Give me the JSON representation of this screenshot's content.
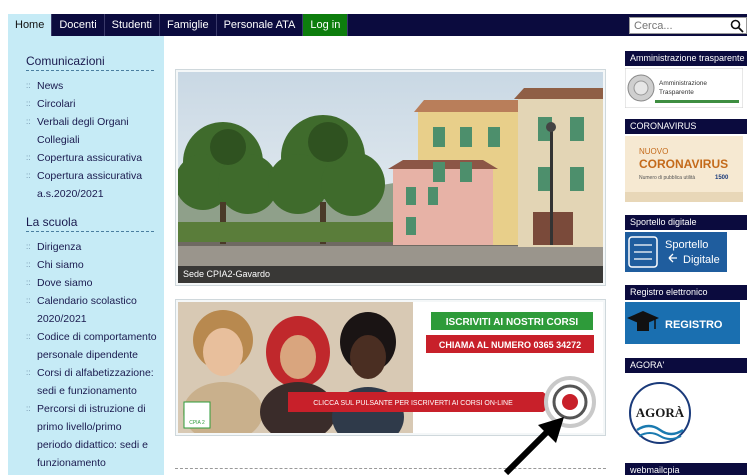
{
  "nav": {
    "items": [
      "Home",
      "Docenti",
      "Studenti",
      "Famiglie",
      "Personale ATA",
      "Log in"
    ],
    "active": "Home"
  },
  "search": {
    "placeholder": "Cerca..."
  },
  "sidebar": {
    "section1": {
      "title": "Comunicazioni",
      "links": [
        "News",
        "Circolari",
        "Verbali degli Organi Collegiali",
        "Copertura assicurativa",
        "Copertura assicurativa a.s.2020/2021"
      ]
    },
    "section2": {
      "title": "La scuola",
      "links": [
        "Dirigenza",
        "Chi siamo",
        "Dove siamo",
        "Calendario scolastico 2020/2021",
        "Codice di comportamento personale dipendente",
        "Corsi di alfabetizzazione: sedi e funzionamento",
        "Percorsi di istruzione di primo livello/primo periodo didattico: sedi e funzionamento"
      ]
    }
  },
  "photo": {
    "caption": "Sede CPIA2-Gavardo"
  },
  "banner": {
    "headline": "ISCRIVITI AI NOSTRI CORSI",
    "phone": "CHIAMA AL NUMERO 0365 34272",
    "cta": "CLICCA SUL PULSANTE PER ISCRIVERTI AI CORSI ON-LINE",
    "logo_text": "CPIA 2"
  },
  "right": {
    "amministrazione": {
      "title": "Amministrazione trasparente",
      "logo_line1": "Amministrazione",
      "logo_line2": "Trasparente"
    },
    "coronavirus": {
      "title": "CORONAVIRUS",
      "small": "NUOVO",
      "big": "CORONAVIRUS",
      "sub": "Numero di pubblica utilità",
      "number": "1500"
    },
    "sportello": {
      "title": "Sportello digitale",
      "line1": "Sportello",
      "line2": "Digitale"
    },
    "registro": {
      "title": "Registro elettronico",
      "label": "REGISTRO"
    },
    "agora": {
      "title": "AGORA'",
      "label": "AGORÀ"
    },
    "webmail": {
      "title": "webmailcpia"
    }
  },
  "colors": {
    "navbar": "#0b0b3e",
    "sidebar": "#c6ebf6",
    "login": "#0d7d0d",
    "banner_green": "#2e9b3a",
    "banner_red": "#c8202a"
  }
}
